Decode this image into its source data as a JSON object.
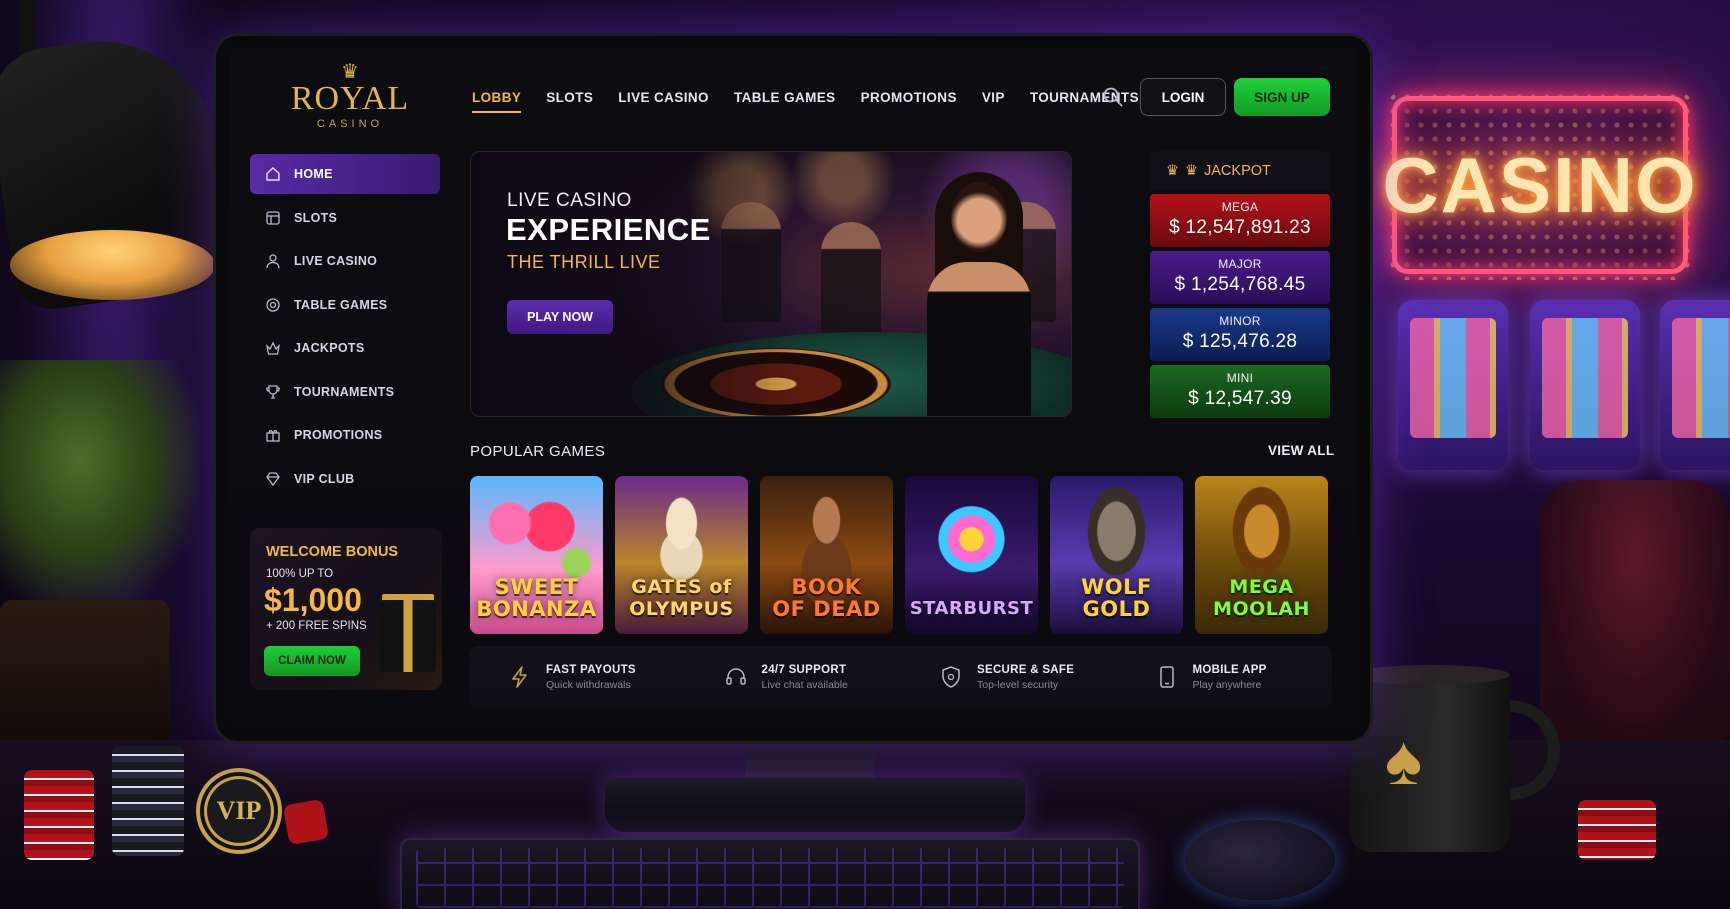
{
  "brand": {
    "crown_glyph": "♛",
    "name": "ROYAL",
    "sub": "CASINO",
    "gold": "#e4b64a"
  },
  "topnav": {
    "items": [
      {
        "label": "LOBBY",
        "active": true
      },
      {
        "label": "SLOTS"
      },
      {
        "label": "LIVE CASINO"
      },
      {
        "label": "TABLE GAMES"
      },
      {
        "label": "PROMOTIONS"
      },
      {
        "label": "VIP"
      },
      {
        "label": "TOURNAMENTS"
      }
    ],
    "search_icon": "search-icon",
    "login_label": "LOGIN",
    "signup_label": "SIGN UP"
  },
  "sidebar": {
    "items": [
      {
        "label": "HOME",
        "icon": "home-icon",
        "active": true
      },
      {
        "label": "SLOTS",
        "icon": "slot-machine-icon"
      },
      {
        "label": "LIVE CASINO",
        "icon": "dealer-icon"
      },
      {
        "label": "TABLE GAMES",
        "icon": "chip-icon"
      },
      {
        "label": "JACKPOTS",
        "icon": "jackpot-icon"
      },
      {
        "label": "TOURNAMENTS",
        "icon": "trophy-icon"
      },
      {
        "label": "PROMOTIONS",
        "icon": "gift-icon"
      },
      {
        "label": "VIP CLUB",
        "icon": "diamond-icon"
      }
    ]
  },
  "bonus": {
    "title": "WELCOME BONUS",
    "line": "100% UP TO",
    "amount": "$1,000",
    "spins": "+ 200 FREE SPINS",
    "cta": "CLAIM NOW"
  },
  "hero": {
    "kicker": "LIVE CASINO",
    "title": "EXPERIENCE",
    "tagline": "THE THRILL LIVE",
    "cta": "PLAY NOW"
  },
  "jackpot": {
    "title": "JACKPOT",
    "tiers": [
      {
        "label": "MEGA",
        "value": "$ 12,547,891.23",
        "color": "#b21218"
      },
      {
        "label": "MAJOR",
        "value": "$ 1,254,768.45",
        "color": "#4a1a8a"
      },
      {
        "label": "MINOR",
        "value": "$ 125,476.28",
        "color": "#183a8a"
      },
      {
        "label": "MINI",
        "value": "$ 12,547.39",
        "color": "#1a6a20"
      }
    ]
  },
  "popular": {
    "title": "POPULAR GAMES",
    "view_all": "VIEW ALL",
    "games": [
      {
        "title": "SWEET BONANZA",
        "line1": "SWEET",
        "line2": "BONANZA"
      },
      {
        "title": "GATES of OLYMPUS",
        "line1": "GATES of",
        "line2": "OLYMPUS"
      },
      {
        "title": "BOOK OF DEAD",
        "line1": "BOOK",
        "line2": "OF DEAD"
      },
      {
        "title": "STARBURST",
        "line1": "",
        "line2": "STARBURST"
      },
      {
        "title": "WOLF GOLD",
        "line1": "WOLF",
        "line2": "GOLD"
      },
      {
        "title": "MEGA MOOLAH",
        "line1": "MEGA",
        "line2": "MOOLAH"
      }
    ]
  },
  "features": [
    {
      "title": "FAST PAYOUTS",
      "sub": "Quick withdrawals",
      "icon": "lightning-icon"
    },
    {
      "title": "24/7 SUPPORT",
      "sub": "Live chat available",
      "icon": "headset-icon"
    },
    {
      "title": "SECURE & SAFE",
      "sub": "Top-level security",
      "icon": "shield-icon"
    },
    {
      "title": "MOBILE APP",
      "sub": "Play anywhere",
      "icon": "phone-icon"
    }
  ],
  "scene": {
    "neon_sign": "CASINO",
    "chip_text": "VIP",
    "mug_glyph": "♠"
  }
}
